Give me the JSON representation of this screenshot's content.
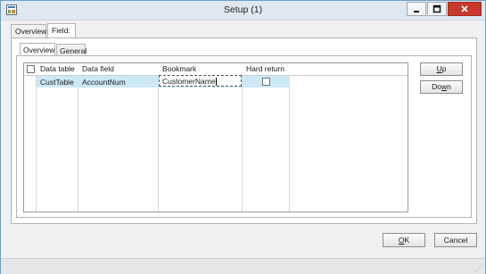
{
  "window": {
    "title": "Setup (1)"
  },
  "tabs": {
    "overview": "Overview",
    "field": "Field:"
  },
  "inner_tabs": {
    "overview": "Overview",
    "general": "General"
  },
  "grid": {
    "headers": [
      "Data table",
      "Data field",
      "Bookmark",
      "Hard return"
    ],
    "rows": [
      {
        "data_table": "CustTable",
        "data_field": "AccountNum",
        "bookmark": "CustomerName",
        "hard_return": false
      }
    ]
  },
  "buttons": {
    "up_key": "U",
    "up_rest": "p",
    "down_pre": "Do",
    "down_key": "w",
    "down_rest": "n",
    "ok_key": "O",
    "ok_rest": "K",
    "cancel": "Cancel"
  },
  "icons": {
    "app": "form-icon",
    "minimize": "minimize-icon",
    "maximize": "maximize-icon",
    "close": "close-icon"
  },
  "colors": {
    "selection": "#cde8f7",
    "close": "#c7392b",
    "titlebar": "#dfe8f1"
  }
}
